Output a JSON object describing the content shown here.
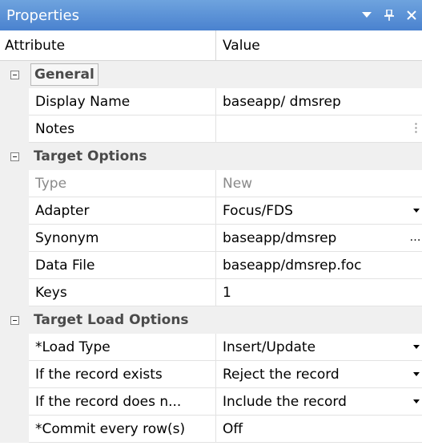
{
  "panel": {
    "title": "Properties",
    "buttons": {
      "menu": "▼",
      "pin": "pin",
      "close": "✕"
    }
  },
  "header": {
    "attribute": "Attribute",
    "value": "Value"
  },
  "categories": [
    {
      "label": "General",
      "items": [
        {
          "name": "Display Name",
          "value": "baseapp/ dmsrep"
        },
        {
          "name": "Notes",
          "value": ""
        }
      ]
    },
    {
      "label": "Target Options",
      "items": [
        {
          "name": "Type",
          "value": "New"
        },
        {
          "name": "Adapter",
          "value": "Focus/FDS"
        },
        {
          "name": "Synonym",
          "value": "baseapp/dmsrep"
        },
        {
          "name": "Data File",
          "value": "baseapp/dmsrep.foc"
        },
        {
          "name": "Keys",
          "value": "1"
        }
      ]
    },
    {
      "label": "Target Load Options",
      "items": [
        {
          "name": "*Load Type",
          "value": "Insert/Update"
        },
        {
          "name": "If the record exists",
          "value": "Reject the record"
        },
        {
          "name": "If the record does n...",
          "value": "Include the record"
        },
        {
          "name": "*Commit every row(s)",
          "value": "Off"
        }
      ]
    }
  ],
  "icons": {
    "menu": "chevron-down-icon",
    "pin": "pin-icon",
    "close": "close-icon",
    "expander": "minus-box-icon",
    "dropdown": "dropdown-arrow-icon",
    "ellipsis": "ellipsis-icon"
  },
  "colors": {
    "titlebar": "#5b91d7",
    "gutter": "#f0f0f0",
    "disabled_text": "#8a8a8a"
  }
}
